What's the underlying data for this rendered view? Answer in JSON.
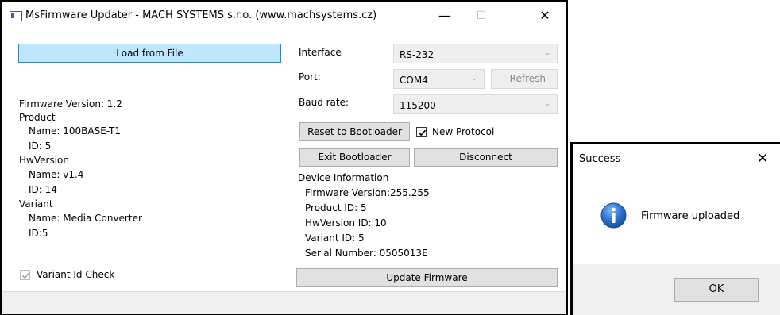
{
  "main_window": {
    "title": "MsFirmware Updater - MACH SYSTEMS s.r.o. (www.machsystems.cz)",
    "minimize_glyph": "—",
    "maximize_glyph": "☐",
    "close_glyph": "✕"
  },
  "left_panel": {
    "load_button": "Load from File",
    "firmware_version": "Firmware Version: 1.2",
    "product_heading": "Product",
    "product_name": "Name: 100BASE-T1",
    "product_id": "ID: 5",
    "hwversion_heading": "HwVersion",
    "hwversion_name": "Name: v1.4",
    "hwversion_id": "ID: 14",
    "variant_heading": "Variant",
    "variant_name": "Name: Media Converter",
    "variant_id": "ID:5",
    "variant_check_label": "Variant Id Check",
    "variant_check_checked": true
  },
  "right_panel": {
    "interface_label": "Interface",
    "interface_value": "RS-232",
    "port_label": "Port:",
    "port_value": "COM4",
    "refresh_button": "Refresh",
    "baud_label": "Baud rate:",
    "baud_value": "115200",
    "reset_button": "Reset to Bootloader",
    "new_protocol_label": "New Protocol",
    "new_protocol_checked": true,
    "exit_button": "Exit Bootloader",
    "disconnect_button": "Disconnect",
    "device_info_heading": "Device Information",
    "device_firmware": "Firmware Version:255.255",
    "device_product": "Product ID: 5",
    "device_hwversion": "HwVersion ID: 10",
    "device_variant": "Variant ID: 5",
    "device_serial": "Serial Number: 0505013E",
    "update_button": "Update Firmware"
  },
  "dialog": {
    "title": "Success",
    "close_glyph": "✕",
    "message": "Firmware uploaded",
    "ok_button": "OK",
    "icon": "info-icon"
  },
  "colors": {
    "accent_button": "#bee6fd",
    "info_icon_blue": "#1e63c4"
  }
}
